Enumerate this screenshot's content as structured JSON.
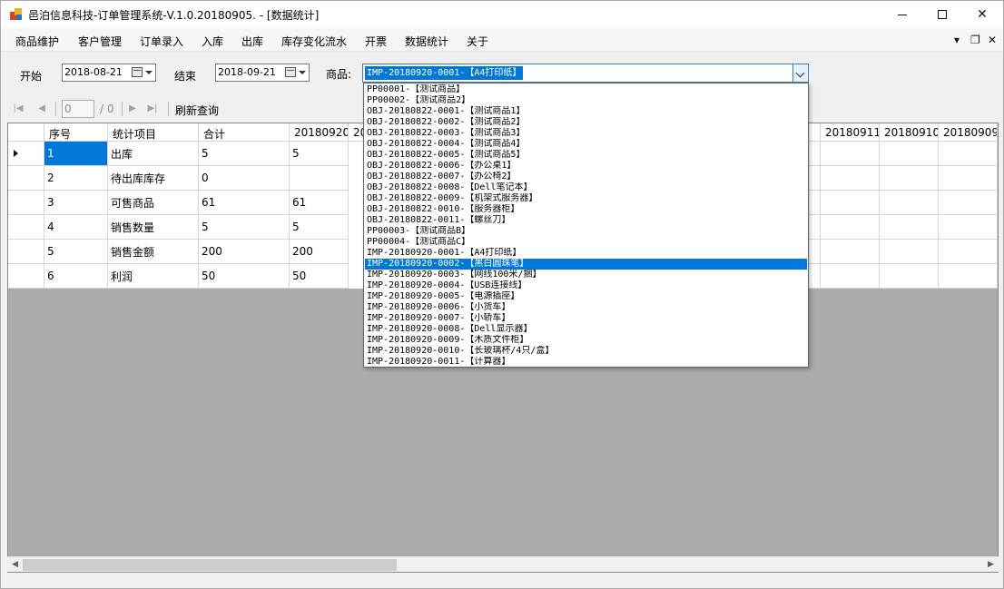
{
  "window": {
    "title": "邑泊信息科技-订单管理系统-V.1.0.20180905. - [数据统计]",
    "controls": {
      "minimize": "minimize-icon",
      "maximize": "maximize-icon",
      "close": "✕"
    }
  },
  "menu": {
    "items": [
      "商品维护",
      "客户管理",
      "订单录入",
      "入库",
      "出库",
      "库存变化流水",
      "开票",
      "数据统计",
      "关于"
    ],
    "mdi_controls": [
      "▾",
      "❐",
      "✕"
    ]
  },
  "filter": {
    "start_label": "开始",
    "start_date": "2018-08-21",
    "end_label": "结束",
    "end_date": "2018-09-21",
    "product_label": "商品:",
    "product_selected": "IMP-20180920-0001-【A4打印纸】"
  },
  "navigator": {
    "current_page": "0",
    "page_count": "/ 0",
    "refresh_label": "刷新查询"
  },
  "grid": {
    "columns_left": [
      "序号",
      "统计项目",
      "合计",
      "20180920",
      "20"
    ],
    "columns_right": [
      "20180911",
      "20180910",
      "20180909"
    ],
    "rows": [
      {
        "no": "1",
        "item": "出库",
        "total": "5",
        "d20180920": "5"
      },
      {
        "no": "2",
        "item": "待出库库存",
        "total": "0",
        "d20180920": ""
      },
      {
        "no": "3",
        "item": "可售商品",
        "total": "61",
        "d20180920": "61"
      },
      {
        "no": "4",
        "item": "销售数量",
        "total": "5",
        "d20180920": "5"
      },
      {
        "no": "5",
        "item": "销售金额",
        "total": "200",
        "d20180920": "200"
      },
      {
        "no": "6",
        "item": "利润",
        "total": "50",
        "d20180920": "50"
      }
    ]
  },
  "dropdown": {
    "highlighted_index": 18,
    "options": [
      "PP00001-【测试商品】",
      "PP00002-【测试商品2】",
      "OBJ-20180822-0001-【测试商品1】",
      "OBJ-20180822-0002-【测试商品2】",
      "OBJ-20180822-0003-【测试商品3】",
      "OBJ-20180822-0004-【测试商品4】",
      "OBJ-20180822-0005-【测试商品5】",
      "OBJ-20180822-0006-【办公桌1】",
      "OBJ-20180822-0007-【办公椅2】",
      "OBJ-20180822-0008-【Dell笔记本】",
      "OBJ-20180822-0009-【机架式服务器】",
      "OBJ-20180822-0010-【服务器柜】",
      "OBJ-20180822-0011-【螺丝刀】",
      "PP00003-【测试商品B】",
      "PP00004-【测试商品C】",
      "IMP-20180920-0001-【A4打印纸】",
      "IMP-20180920-0002-【黑白圆珠笔】",
      "IMP-20180920-0003-【网线100米/捆】",
      "IMP-20180920-0004-【USB连接线】",
      "IMP-20180920-0005-【电源插座】",
      "IMP-20180920-0006-【小货车】",
      "IMP-20180920-0007-【小轿车】",
      "IMP-20180920-0008-【Dell显示器】",
      "IMP-20180920-0009-【木质文件柜】",
      "IMP-20180920-0010-【长玻璃杯/4只/盒】",
      "IMP-20180920-0011-【计算器】"
    ]
  }
}
